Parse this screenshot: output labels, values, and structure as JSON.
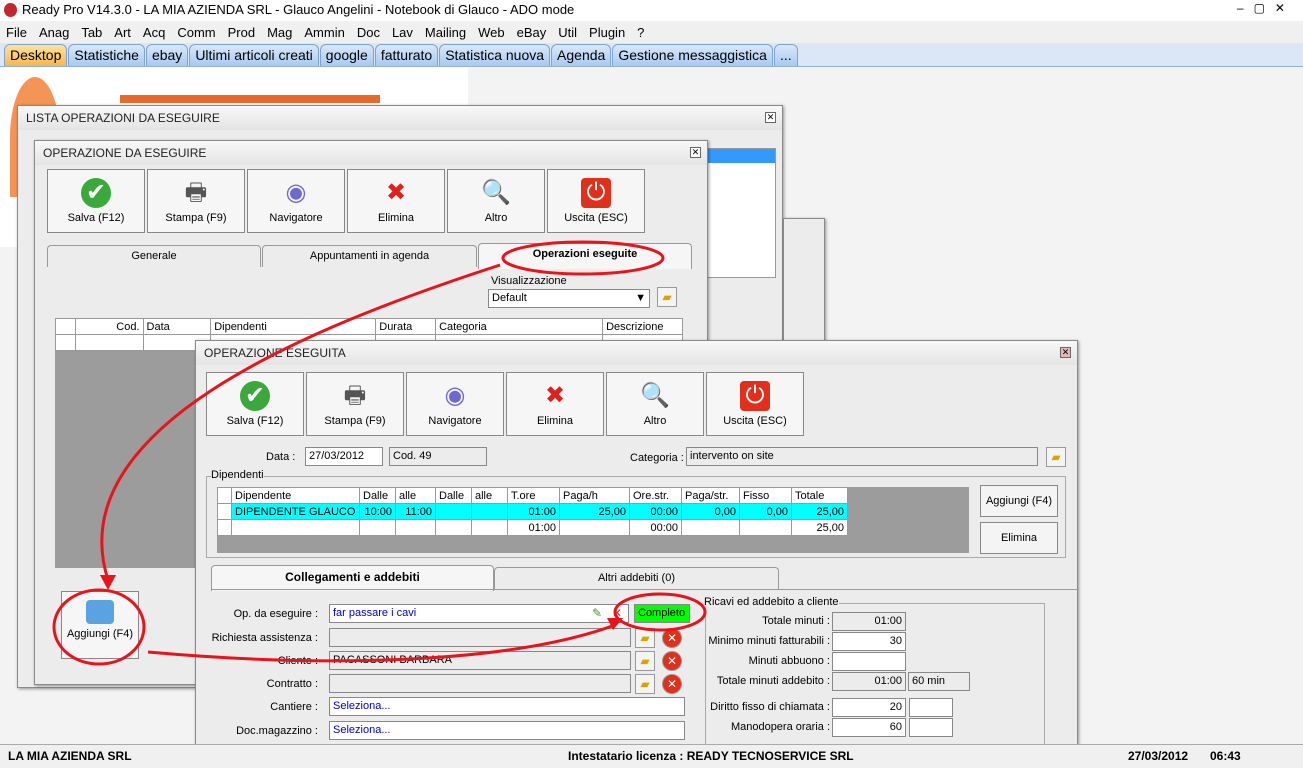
{
  "app": {
    "title": "Ready Pro V14.3.0 - LA MIA AZIENDA SRL - Glauco Angelini - Notebook di Glauco - ADO mode"
  },
  "menu": [
    "File",
    "Anag",
    "Tab",
    "Art",
    "Acq",
    "Comm",
    "Prod",
    "Mag",
    "Ammin",
    "Doc",
    "Lav",
    "Mailing",
    "Web",
    "eBay",
    "Util",
    "Plugin",
    "?"
  ],
  "tabs": [
    "Desktop",
    "Statistiche",
    "ebay",
    "Ultimi articoli creati",
    "google",
    "fatturato",
    "Statistica nuova",
    "Agenda",
    "Gestione messaggistica",
    "..."
  ],
  "lista": {
    "title": "LISTA OPERAZIONI DA ESEGUIRE"
  },
  "opdaeseguire": {
    "title": "OPERAZIONE DA ESEGUIRE",
    "toolbar": [
      "Salva (F12)",
      "Stampa (F9)",
      "Navigatore",
      "Elimina",
      "Altro",
      "Uscita (ESC)"
    ],
    "tabs": [
      "Generale",
      "Appuntamenti in agenda",
      "Operazioni eseguite"
    ],
    "visualizzazione_label": "Visualizzazione",
    "visualizzazione_value": "Default",
    "columns": [
      "Cod.",
      "Data",
      "Dipendenti",
      "Durata",
      "Categoria",
      "Descrizione"
    ],
    "add_button": "Aggiungi (F4)"
  },
  "opeseguita": {
    "title": "OPERAZIONE ESEGUITA",
    "toolbar": [
      "Salva (F12)",
      "Stampa (F9)",
      "Navigatore",
      "Elimina",
      "Altro",
      "Uscita (ESC)"
    ],
    "data_label": "Data :",
    "data_value": "27/03/2012",
    "cod": "Cod. 49",
    "categoria_label": "Categoria :",
    "categoria_value": "intervento on site",
    "dipendenti_label": "Dipendenti",
    "columns": [
      "Dipendente",
      "Dalle",
      "alle",
      "Dalle",
      "alle",
      "T.ore",
      "Paga/h",
      "Ore.str.",
      "Paga/str.",
      "Fisso",
      "Totale"
    ],
    "rows": [
      [
        "DIPENDENTE GLAUCO",
        "10:00",
        "11:00",
        "",
        "",
        "01:00",
        "25,00",
        "00:00",
        "0,00",
        "0,00",
        "25,00"
      ],
      [
        "",
        "",
        "",
        "",
        "",
        "01:00",
        "",
        "00:00",
        "",
        "",
        "25,00"
      ]
    ],
    "aggiungi": "Aggiungi (F4)",
    "elimina": "Elimina",
    "tabs": [
      "Collegamenti e addebiti",
      "Altri addebiti (0)"
    ],
    "fields": {
      "op_label": "Op. da eseguire :",
      "op_value": "far passare i cavi",
      "status": "Completo",
      "status_color": "#00ff00",
      "richiesta_label": "Richiesta assistenza :",
      "cliente_label": "Cliente :",
      "cliente_value": "PACASSONI BARBARA",
      "contratto_label": "Contratto :",
      "cantiere_label": "Cantiere :",
      "cantiere_value": "Seleziona...",
      "docmag_label": "Doc.magazzino :",
      "docmag_value": "Seleziona..."
    },
    "ricavi": {
      "title": "Ricavi ed addebito a cliente",
      "totale_minuti_label": "Totale minuti :",
      "totale_minuti": "01:00",
      "minimo_label": "Minimo minuti fatturabili :",
      "minimo": "30",
      "abbuono_label": "Minuti abbuono :",
      "abbuono": "",
      "addebito_label": "Totale minuti addebito :",
      "addebito": "01:00",
      "addebito_min": "60 min",
      "diritto_label": "Diritto fisso di chiamata :",
      "diritto": "20",
      "manodopera_label": "Manodopera oraria :",
      "manodopera": "60"
    }
  },
  "status": {
    "company": "LA MIA AZIENDA SRL",
    "license": "Intestatario licenza : READY TECNOSERVICE SRL",
    "date": "27/03/2012",
    "time": "06:43"
  }
}
